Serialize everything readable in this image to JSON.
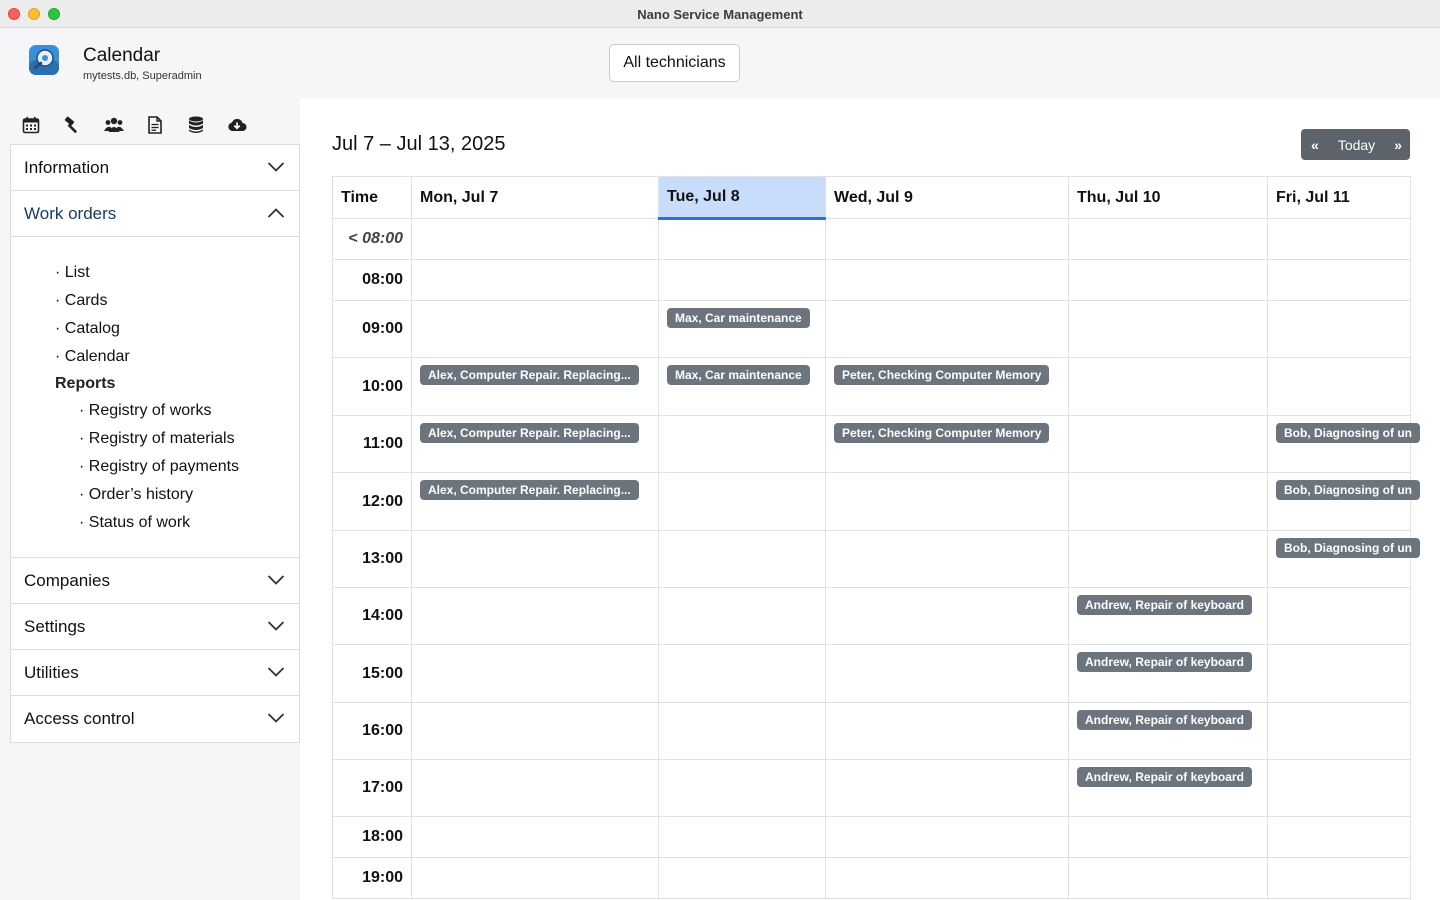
{
  "window": {
    "title": "Nano Service Management"
  },
  "header": {
    "title": "Calendar",
    "subtitle": "mytests.db, Superadmin",
    "technician_filter": "All technicians"
  },
  "toolbar": {
    "icons": [
      "calendar-icon",
      "hammer-icon",
      "users-icon",
      "document-icon",
      "database-icon",
      "cloud-download-icon"
    ]
  },
  "sidebar": {
    "information": "Information",
    "work_orders": {
      "label": "Work orders",
      "items": [
        "· List",
        "· Cards",
        "· Catalog",
        "· Calendar"
      ],
      "reports_label": "Reports",
      "reports": [
        "· Registry of works",
        "· Registry of materials",
        "· Registry of payments",
        "· Order’s history",
        "· Status of work"
      ]
    },
    "companies": "Companies",
    "settings": "Settings",
    "utilities": "Utilities",
    "access_control": "Access control"
  },
  "calendar": {
    "range_title": "Jul 7 – Jul 13, 2025",
    "nav": {
      "prev": "«",
      "today": "Today",
      "next": "»"
    },
    "time_header": "Time",
    "days": [
      "Mon, Jul 7",
      "Tue, Jul 8",
      "Wed, Jul 9",
      "Thu, Jul 10",
      "Fri, Jul 11"
    ],
    "today_index": 1,
    "rows": [
      {
        "time": "< 08:00",
        "events": [
          "",
          "",
          "",
          "",
          ""
        ]
      },
      {
        "time": "08:00",
        "events": [
          "",
          "",
          "",
          "",
          ""
        ]
      },
      {
        "time": "09:00",
        "events": [
          "",
          "Max, Car maintenance",
          "",
          "",
          ""
        ]
      },
      {
        "time": "10:00",
        "events": [
          "Alex, Computer Repair. Replacing...",
          "Max, Car maintenance",
          "Peter, Checking Computer Memory",
          "",
          ""
        ]
      },
      {
        "time": "11:00",
        "events": [
          "Alex, Computer Repair. Replacing...",
          "",
          "Peter, Checking Computer Memory",
          "",
          "Bob, Diagnosing of un"
        ]
      },
      {
        "time": "12:00",
        "events": [
          "Alex, Computer Repair. Replacing...",
          "",
          "",
          "",
          "Bob, Diagnosing of un"
        ]
      },
      {
        "time": "13:00",
        "events": [
          "",
          "",
          "",
          "",
          "Bob, Diagnosing of un"
        ]
      },
      {
        "time": "14:00",
        "events": [
          "",
          "",
          "",
          "Andrew, Repair of keyboard",
          ""
        ]
      },
      {
        "time": "15:00",
        "events": [
          "",
          "",
          "",
          "Andrew, Repair of keyboard",
          ""
        ]
      },
      {
        "time": "16:00",
        "events": [
          "",
          "",
          "",
          "Andrew, Repair of keyboard",
          ""
        ]
      },
      {
        "time": "17:00",
        "events": [
          "",
          "",
          "",
          "Andrew, Repair of keyboard",
          ""
        ]
      },
      {
        "time": "18:00",
        "events": [
          "",
          "",
          "",
          "",
          ""
        ]
      },
      {
        "time": "19:00",
        "events": [
          "",
          "",
          "",
          "",
          ""
        ]
      }
    ]
  },
  "colors": {
    "event_bg": "#6c757d",
    "today_bg": "#c8dcfb",
    "today_accent": "#2f6fe0",
    "nav_bg": "#5c636a"
  }
}
